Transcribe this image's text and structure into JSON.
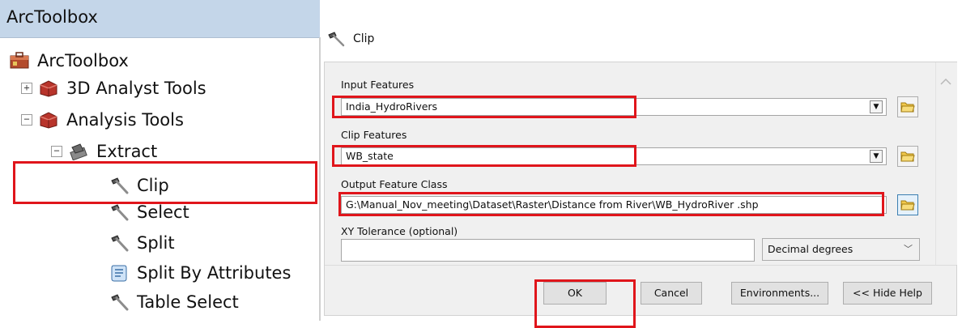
{
  "toolbox": {
    "header_title": "ArcToolbox",
    "items": [
      {
        "label": "ArcToolbox",
        "icon": "toolbox-icon"
      },
      {
        "label": "3D Analyst Tools",
        "icon": "toolset-box-icon",
        "expander": "+"
      },
      {
        "label": "Analysis Tools",
        "icon": "toolset-box-icon",
        "expander": "−"
      },
      {
        "label": "Extract",
        "icon": "toolset-icon",
        "expander": "−"
      },
      {
        "label": "Clip",
        "icon": "hammer-icon"
      },
      {
        "label": "Select",
        "icon": "hammer-icon"
      },
      {
        "label": "Split",
        "icon": "hammer-icon"
      },
      {
        "label": "Split By Attributes",
        "icon": "script-icon"
      },
      {
        "label": "Table Select",
        "icon": "hammer-icon"
      }
    ]
  },
  "dialog": {
    "title": "Clip",
    "fields": {
      "input_features": {
        "label": "Input Features",
        "value": "India_HydroRivers"
      },
      "clip_features": {
        "label": "Clip Features",
        "value": "WB_state"
      },
      "output_feature_class": {
        "label": "Output Feature Class",
        "value": "G:\\Manual_Nov_meeting\\Dataset\\Raster\\Distance from River\\WB_HydroRiver .shp"
      },
      "xy_tolerance": {
        "label": "XY Tolerance (optional)",
        "value": "",
        "units": "Decimal degrees"
      }
    },
    "buttons": {
      "ok": "OK",
      "cancel": "Cancel",
      "environments": "Environments...",
      "hide_help": "<< Hide Help"
    }
  },
  "colors": {
    "highlight": "#e0151b",
    "header_bg": "#c4d6e9",
    "dialog_panel": "#f0f0f0"
  }
}
